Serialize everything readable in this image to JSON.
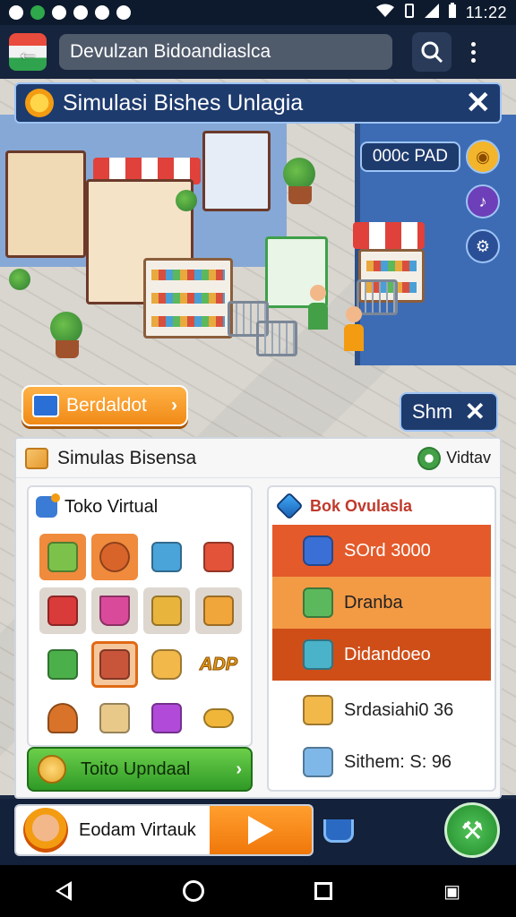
{
  "statusbar": {
    "time": "11:22"
  },
  "appbar": {
    "url_text": "Devulzan Bidoandiaslca"
  },
  "scene": {
    "title": "Simulasi Bishes Unlagia",
    "coin_label": "000c PAD",
    "cta_label": "Berdaldot",
    "shop_label": "Shm"
  },
  "panel": {
    "header_title": "Simulas Bisensa",
    "header_right": "Vidtav",
    "left_card": {
      "title": "Toko Virtual",
      "button_label": "Toito Upndaal",
      "special_tile": "ADP"
    },
    "right_card": {
      "title": "Bok Ovulasla",
      "rows": [
        {
          "label": "SOrd 3000"
        },
        {
          "label": "Dranba"
        },
        {
          "label": "Didandoeo"
        },
        {
          "label": "Srdasiahi0 36"
        },
        {
          "label": "Sithem: S: 96"
        }
      ]
    }
  },
  "bottombar": {
    "profile_name": "Eodam Virtauk"
  },
  "colors": {
    "accent_orange": "#f08a16",
    "accent_blue": "#1e3b6e",
    "accent_green": "#2f9a26"
  }
}
